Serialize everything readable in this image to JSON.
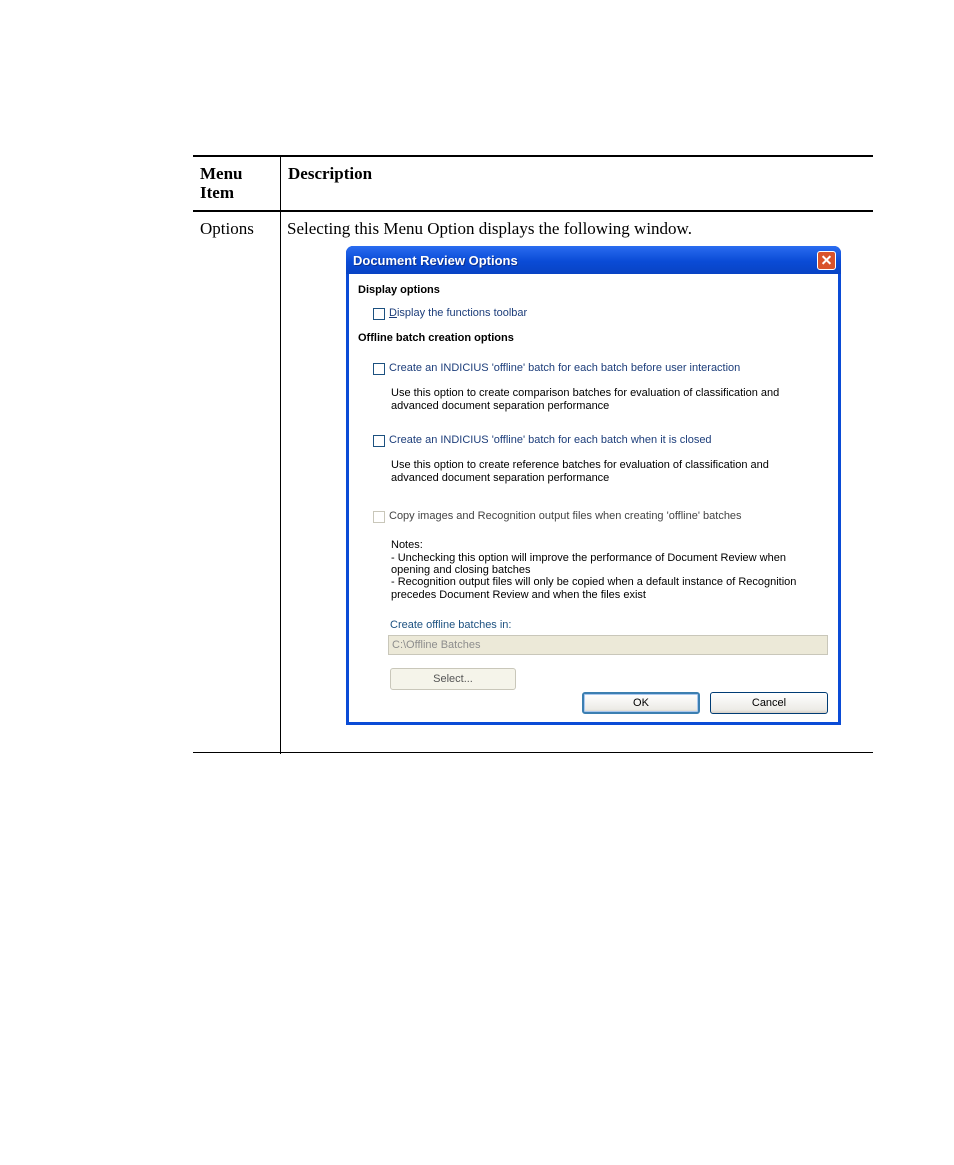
{
  "table": {
    "header_menu_item": "Menu Item",
    "header_description": "Description",
    "row_item": "Options",
    "row_description": "Selecting this Menu Option displays the following window."
  },
  "dialog": {
    "title": "Document Review Options",
    "display_section": "Display options",
    "display_toolbar_label": "Display the functions toolbar",
    "display_toolbar_checked": false,
    "offline_section": "Offline batch creation options",
    "before_label": "Create an INDICIUS 'offline' batch for each batch before user interaction",
    "before_checked": false,
    "before_note_1": "Use this option to create comparison batches for evaluation of classification and",
    "before_note_2": "advanced document separation performance",
    "closed_label": "Create an INDICIUS 'offline' batch for each batch when it is closed",
    "closed_checked": false,
    "closed_note_1": "Use this option to create reference batches for evaluation of classification and",
    "closed_note_2": "advanced document separation performance",
    "copy_label": "Copy images and Recognition output files when creating 'offline' batches",
    "copy_checked": false,
    "notes_1": "Notes:",
    "notes_2": "-  Unchecking this option will improve the performance of Document Review when",
    "notes_3": "opening and closing batches",
    "notes_4": "-  Recognition output files will only be copied when a default instance of Recognition",
    "notes_5": "precedes Document Review and when the files exist",
    "folder_label": "Create offline batches in:",
    "folder_value": "C:\\Offline Batches",
    "select_button": "Select...",
    "ok_button": "OK",
    "cancel_button": "Cancel"
  }
}
